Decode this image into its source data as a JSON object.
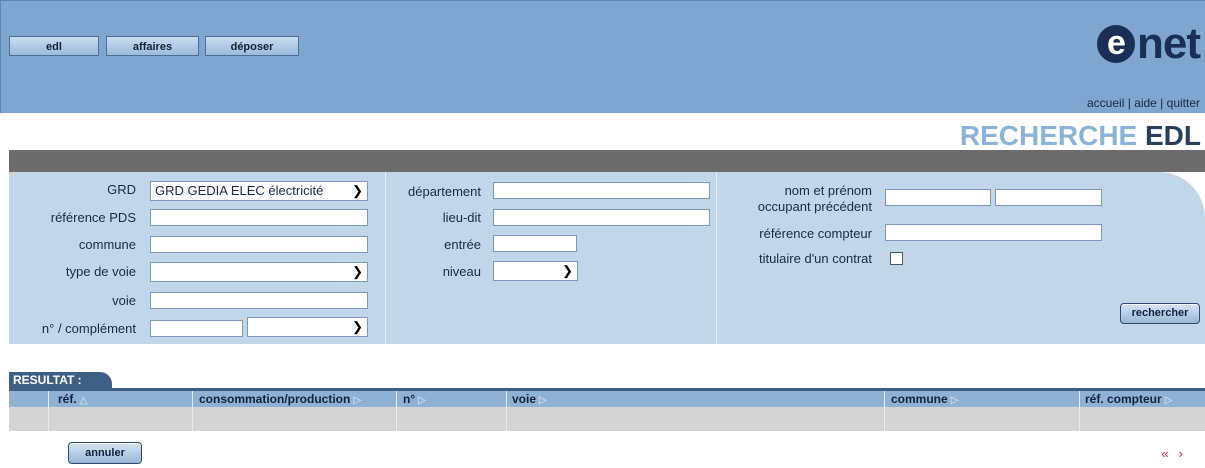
{
  "nav": {
    "tabs": [
      "edl",
      "affaires",
      "déposer"
    ],
    "logo": "enet",
    "links": {
      "home": "accueil",
      "help": "aide",
      "quit": "quitter",
      "sep": " | "
    }
  },
  "page_title": {
    "part1": "RECHERCHE ",
    "part2": "EDL"
  },
  "form": {
    "grd": {
      "label": "GRD",
      "value": "GRD GEDIA ELEC électricité"
    },
    "ref_pds": {
      "label": "référence PDS",
      "value": ""
    },
    "commune": {
      "label": "commune",
      "value": ""
    },
    "type_voie": {
      "label": "type de voie",
      "value": ""
    },
    "voie": {
      "label": "voie",
      "value": ""
    },
    "num_complement": {
      "label": "n° / complément",
      "value": "",
      "complement": ""
    },
    "departement": {
      "label": "département",
      "value": ""
    },
    "lieu_dit": {
      "label": "lieu-dit",
      "value": ""
    },
    "entree": {
      "label": "entrée",
      "value": ""
    },
    "niveau": {
      "label": "niveau",
      "value": ""
    },
    "occupant": {
      "label_line1": "nom et prénom",
      "label_line2": "occupant précédent",
      "nom": "",
      "prenom": ""
    },
    "ref_compteur": {
      "label": "référence compteur",
      "value": ""
    },
    "titulaire": {
      "label": "titulaire d'un contrat",
      "checked": false
    },
    "search_button": "rechercher"
  },
  "results": {
    "tab_label": "RESULTAT :",
    "columns": [
      "réf.",
      "consommation/production",
      "n°",
      "voie",
      "commune",
      "réf. compteur"
    ],
    "rows": []
  },
  "cancel_button": "annuler",
  "pager": {
    "prev": "«",
    "next": "›"
  }
}
